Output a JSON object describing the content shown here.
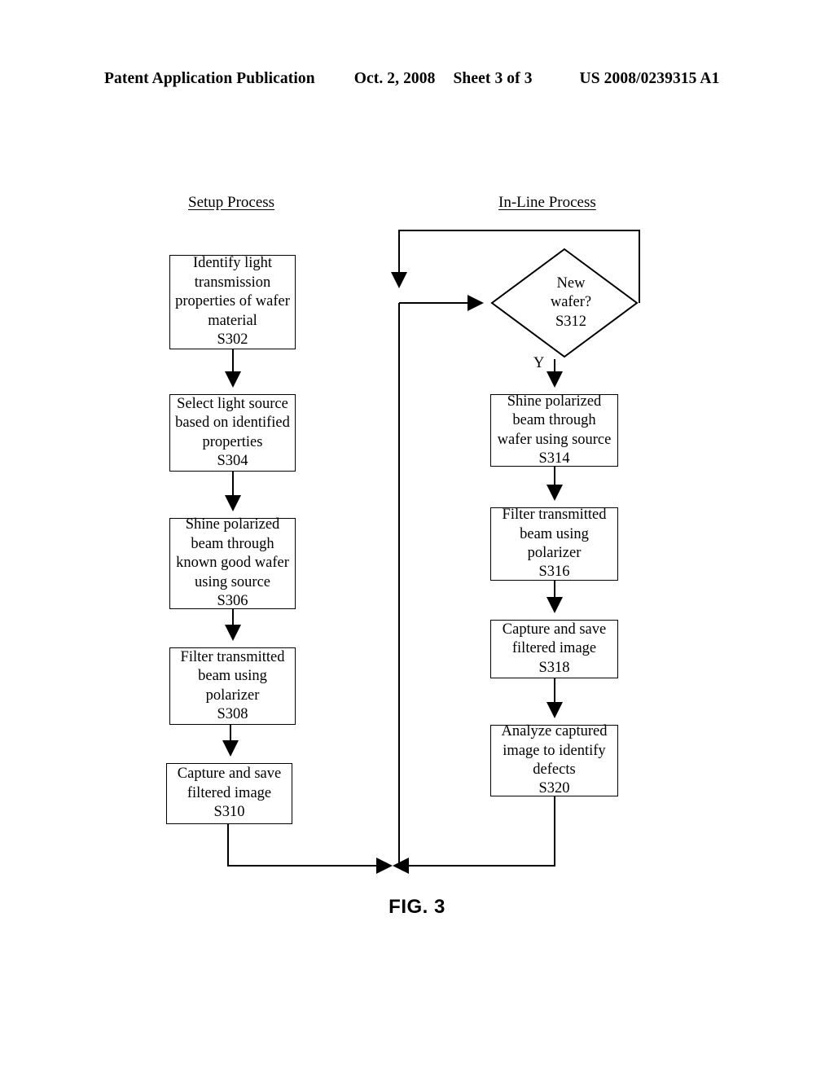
{
  "header": {
    "publication": "Patent Application Publication",
    "date": "Oct. 2, 2008",
    "sheet": "Sheet 3 of 3",
    "patent_number": "US 2008/0239315 A1"
  },
  "figure": {
    "caption": "FIG. 3"
  },
  "columns": {
    "setup_heading": "Setup Process",
    "inline_heading": "In-Line Process"
  },
  "branch_labels": {
    "yes": "Y"
  },
  "nodes": {
    "s302": {
      "lines": [
        "Identify light",
        "transmission",
        "properties of wafer",
        "material",
        "S302"
      ],
      "step_id": "S302"
    },
    "s304": {
      "lines": [
        "Select light source",
        "based on identified",
        "properties",
        "S304"
      ],
      "step_id": "S304"
    },
    "s306": {
      "lines": [
        "Shine polarized",
        "beam through",
        "known good wafer",
        "using source",
        "S306"
      ],
      "step_id": "S306"
    },
    "s308": {
      "lines": [
        "Filter transmitted",
        "beam using",
        "polarizer",
        "S308"
      ],
      "step_id": "S308"
    },
    "s310": {
      "lines": [
        "Capture and save",
        "filtered image",
        "S310"
      ],
      "step_id": "S310"
    },
    "s312": {
      "lines": [
        "New",
        "wafer?",
        "S312"
      ],
      "step_id": "S312"
    },
    "s314": {
      "lines": [
        "Shine polarized",
        "beam through",
        "wafer using source",
        "S314"
      ],
      "step_id": "S314"
    },
    "s316": {
      "lines": [
        "Filter transmitted",
        "beam using",
        "polarizer",
        "S316"
      ],
      "step_id": "S316"
    },
    "s318": {
      "lines": [
        "Capture and save",
        "filtered image",
        "S318"
      ],
      "step_id": "S318"
    },
    "s320": {
      "lines": [
        "Analyze captured",
        "image to identify",
        "defects",
        "S320"
      ],
      "step_id": "S320"
    }
  },
  "colors": {
    "ink": "#000000",
    "paper": "#ffffff"
  }
}
